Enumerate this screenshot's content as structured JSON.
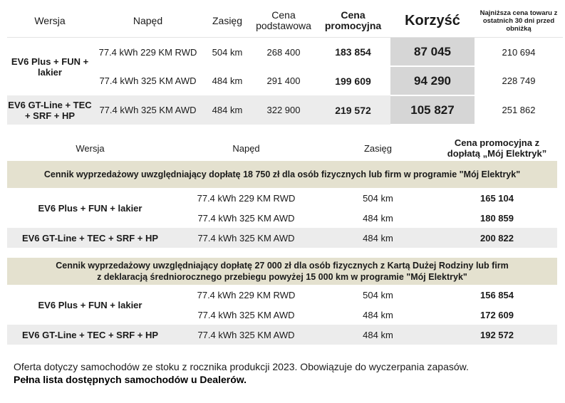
{
  "table1": {
    "headers": {
      "wersja": "Wersja",
      "naped": "Napęd",
      "zasieg": "Zasięg",
      "cena_podst": "Cena podstawowa",
      "cena_promo": "Cena promocyjna",
      "korzysc": "Korzyść",
      "najnizsza": "Najniższa cena towaru z ostatnich 30 dni przed obniżką"
    },
    "groups": [
      {
        "model": "EV6 Plus + FUN + lakier",
        "rows": [
          {
            "naped": "77.4 kWh 229 KM RWD",
            "zasieg": "504 km",
            "cena_podst": "268 400",
            "cena_promo": "183 854",
            "korzysc": "87 045",
            "najnizsza": "210 694"
          },
          {
            "naped": "77.4 kWh 325 KM AWD",
            "zasieg": "484 km",
            "cena_podst": "291 400",
            "cena_promo": "199 609",
            "korzysc": "94 290",
            "najnizsza": "228 749"
          }
        ]
      },
      {
        "model": "EV6 GT-Line + TEC + SRF + HP",
        "rows": [
          {
            "naped": "77.4 kWh 325 KM AWD",
            "zasieg": "484 km",
            "cena_podst": "322 900",
            "cena_promo": "219 572",
            "korzysc": "105 827",
            "najnizsza": "251 862"
          }
        ]
      }
    ]
  },
  "table2": {
    "headers": {
      "wersja": "Wersja",
      "naped": "Napęd",
      "zasieg": "Zasięg",
      "cena_promo": "Cena promocyjna z dopłatą „Mój Elektryk”"
    },
    "sections": [
      {
        "banner": "Cennik wyprzedażowy uwzględniający dopłatę 18 750 zł dla osób fizycznych lub firm w programie \"Mój Elektryk\"",
        "groups": [
          {
            "model": "EV6 Plus + FUN + lakier",
            "rows": [
              {
                "naped": "77.4 kWh 229 KM RWD",
                "zasieg": "504 km",
                "cena": "165 104"
              },
              {
                "naped": "77.4 kWh 325 KM AWD",
                "zasieg": "484 km",
                "cena": "180 859"
              }
            ]
          },
          {
            "model": "EV6 GT-Line + TEC + SRF + HP",
            "rows": [
              {
                "naped": "77.4 kWh 325 KM AWD",
                "zasieg": "484 km",
                "cena": "200 822"
              }
            ]
          }
        ]
      },
      {
        "banner_line1": "Cennik wyprzedażowy uwzględniający dopłatę 27 000 zł dla osób fizycznych z Kartą Dużej Rodziny lub firm",
        "banner_line2": "z deklaracją średniorocznego przebiegu powyżej 15 000 km w programie \"Mój Elektryk\"",
        "groups": [
          {
            "model": "EV6 Plus + FUN + lakier",
            "rows": [
              {
                "naped": "77.4 kWh 229 KM RWD",
                "zasieg": "504 km",
                "cena": "156 854"
              },
              {
                "naped": "77.4 kWh 325 KM AWD",
                "zasieg": "484 km",
                "cena": "172 609"
              }
            ]
          },
          {
            "model": "EV6 GT-Line + TEC + SRF + HP",
            "rows": [
              {
                "naped": "77.4 kWh 325 KM AWD",
                "zasieg": "484 km",
                "cena": "192 572"
              }
            ]
          }
        ]
      }
    ]
  },
  "footer": {
    "line1": "Oferta dotyczy samochodów ze stoku z rocznika produkcji 2023. Obowiązuje do wyczerpania zapasów.",
    "line2": "Pełna lista dostępnych samochodów u Dealerów."
  }
}
